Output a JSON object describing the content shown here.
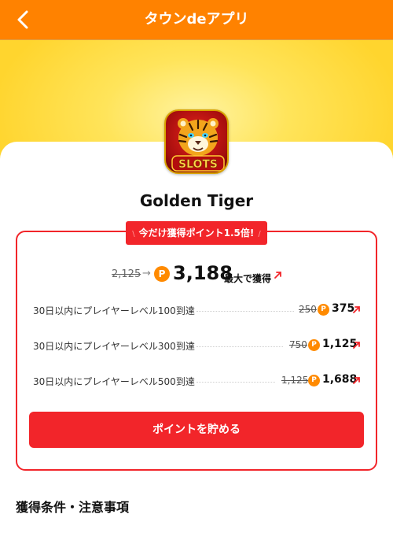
{
  "header": {
    "title": "タウンdeアプリ",
    "back_icon": "chevron-left-icon"
  },
  "app": {
    "name": "Golden Tiger",
    "icon_text": "SLOTS"
  },
  "promo": {
    "text": "今だけ獲得ポイント1.5倍!",
    "left_deco": "\\",
    "right_deco": "/"
  },
  "points": {
    "old_total": "2,125",
    "new_total": "3,188",
    "max_label": "最大で獲得",
    "coin_symbol": "P"
  },
  "tasks": [
    {
      "label": "30日以内にプレイヤーレベル100到達",
      "old": "250",
      "new": "375"
    },
    {
      "label": "30日以内にプレイヤーレベル300到達",
      "old": "750",
      "new": "1,125"
    },
    {
      "label": "30日以内にプレイヤーレベル500到達",
      "old": "1,125",
      "new": "1,688"
    }
  ],
  "cta_label": "ポイントを貯める",
  "terms_heading": "獲得条件・注意事項",
  "colors": {
    "header": "#ff8200",
    "accent_red": "#f2252a",
    "coin": "#ff8a00",
    "hero_yellow": "#ffd52e"
  }
}
